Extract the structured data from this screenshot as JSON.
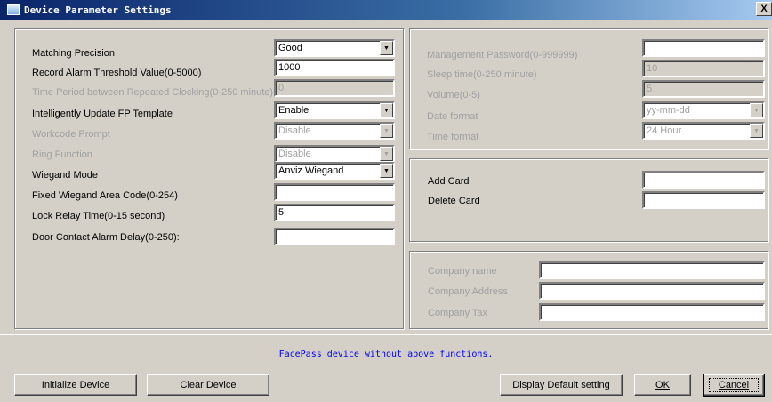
{
  "window": {
    "title": "Device Parameter Settings",
    "close_label": "X"
  },
  "left": {
    "matching_precision": {
      "label": "Matching Precision",
      "value": "Good"
    },
    "record_alarm": {
      "label": "Record Alarm Threshold Value(0-5000)",
      "value": "1000"
    },
    "time_period": {
      "label": "Time Period between Repeated Clocking(0-250 minute)",
      "value": "0"
    },
    "update_fp": {
      "label": "Intelligently Update  FP Template",
      "value": "Enable"
    },
    "workcode": {
      "label": "Workcode Prompt",
      "value": "Disable"
    },
    "ring": {
      "label": "Ring Function",
      "value": "Disable"
    },
    "wiegand_mode": {
      "label": "Wiegand Mode",
      "value": "Anviz Wiegand"
    },
    "wiegand_area": {
      "label": "Fixed Wiegand Area Code(0-254)",
      "value": ""
    },
    "lock_relay": {
      "label": "Lock Relay Time(0-15 second)",
      "value": "5"
    },
    "door_contact": {
      "label": "Door Contact Alarm Delay(0-250):",
      "value": ""
    }
  },
  "right_top": {
    "mgmt_password": {
      "label": "Management Password(0-999999)",
      "value": ""
    },
    "sleep_time": {
      "label": "Sleep time(0-250 minute)",
      "value": "10"
    },
    "volume": {
      "label": "Volume(0-5)",
      "value": "5"
    },
    "date_format": {
      "label": "Date format",
      "value": "yy-mm-dd"
    },
    "time_format": {
      "label": "Time format",
      "value": "24 Hour"
    }
  },
  "cards": {
    "add_card": {
      "label": "Add Card",
      "value": ""
    },
    "delete_card": {
      "label": "Delete Card",
      "value": ""
    }
  },
  "company": {
    "name": {
      "label": "Company name",
      "value": ""
    },
    "address": {
      "label": "Company Address",
      "value": ""
    },
    "tax": {
      "label": "Company Tax",
      "value": ""
    }
  },
  "note": "FacePass device without above functions.",
  "buttons": {
    "initialize": "Initialize Device",
    "clear": "Clear Device",
    "display_default": "Display Default setting",
    "ok": "OK",
    "cancel": "Cancel"
  }
}
